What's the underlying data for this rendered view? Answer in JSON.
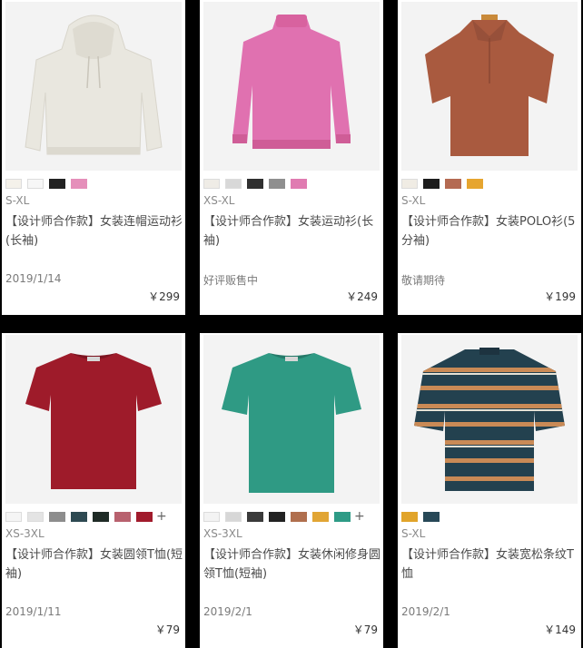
{
  "products": [
    {
      "sizes": "S-XL",
      "title": "【设计师合作款】女装连帽运动衫(长袖)",
      "status": "2019/1/14",
      "price": "￥299",
      "swatches": [
        "#f4f1ea",
        "#f7f7f7",
        "#222222",
        "#e58fba"
      ],
      "more": ""
    },
    {
      "sizes": "XS-XL",
      "title": "【设计师合作款】女装运动衫(长袖)",
      "status": "好评贩售中",
      "price": "￥249",
      "swatches": [
        "#efece6",
        "#d8d8d8",
        "#2f2f2f",
        "#8f8f8f",
        "#e07bb1"
      ],
      "more": ""
    },
    {
      "sizes": "S-XL",
      "title": "【设计师合作款】女装POLO衫(5分袖)",
      "status": "敬请期待",
      "price": "￥199",
      "swatches": [
        "#f0ece4",
        "#1d1d1d",
        "#b46a52",
        "#e6a52f"
      ],
      "more": ""
    },
    {
      "sizes": "XS-3XL",
      "title": "【设计师合作款】女装圆领T恤(短袖)",
      "status": "2019/1/11",
      "price": "￥79",
      "swatches": [
        "#f5f5f5",
        "#e4e4e4",
        "#8d8d8d",
        "#2e4a52",
        "#1f2b26",
        "#b8616e",
        "#a11b2c"
      ],
      "more": "+"
    },
    {
      "sizes": "XS-3XL",
      "title": "【设计师合作款】女装休闲修身圆领T恤(短袖)",
      "status": "2019/2/1",
      "price": "￥79",
      "swatches": [
        "#f3f3f3",
        "#d7d7d7",
        "#3a3a3a",
        "#222222",
        "#b06f4e",
        "#e1a534",
        "#2e9b86"
      ],
      "more": "+"
    },
    {
      "sizes": "S-XL",
      "title": "【设计师合作款】女装宽松条纹T恤",
      "status": "2019/2/1",
      "price": "￥149",
      "swatches": [
        "#e1a42a",
        "#274857"
      ],
      "more": ""
    }
  ]
}
